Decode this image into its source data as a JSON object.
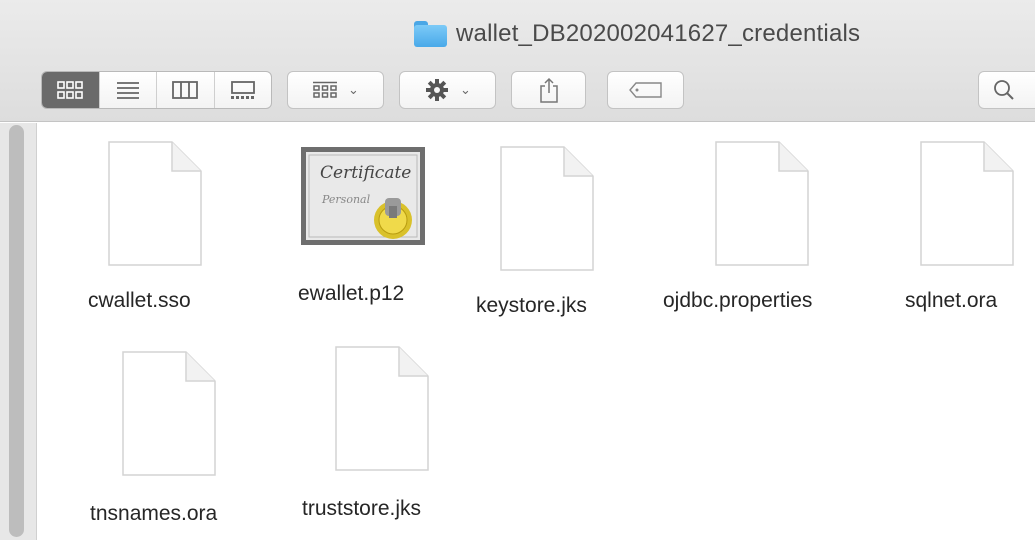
{
  "window": {
    "title": "wallet_DB202002041627_credentials"
  },
  "toolbar": {
    "view_modes": [
      {
        "name": "icon-view",
        "active": true
      },
      {
        "name": "list-view",
        "active": false
      },
      {
        "name": "column-view",
        "active": false
      },
      {
        "name": "gallery-view",
        "active": false
      }
    ],
    "group_icon": "group-icon",
    "action_icon": "gear-icon",
    "share_icon": "share-icon",
    "tag_icon": "tag-icon",
    "search_icon": "search-icon"
  },
  "files": [
    {
      "name": "cwallet.sso",
      "type": "document"
    },
    {
      "name": "ewallet.p12",
      "type": "certificate"
    },
    {
      "name": "keystore.jks",
      "type": "document"
    },
    {
      "name": "ojdbc.properties",
      "type": "document"
    },
    {
      "name": "sqlnet.ora",
      "type": "document"
    },
    {
      "name": "tnsnames.ora",
      "type": "document"
    },
    {
      "name": "truststore.jks",
      "type": "document"
    }
  ],
  "certificate": {
    "line1": "Certificate",
    "line2": "Personal"
  }
}
